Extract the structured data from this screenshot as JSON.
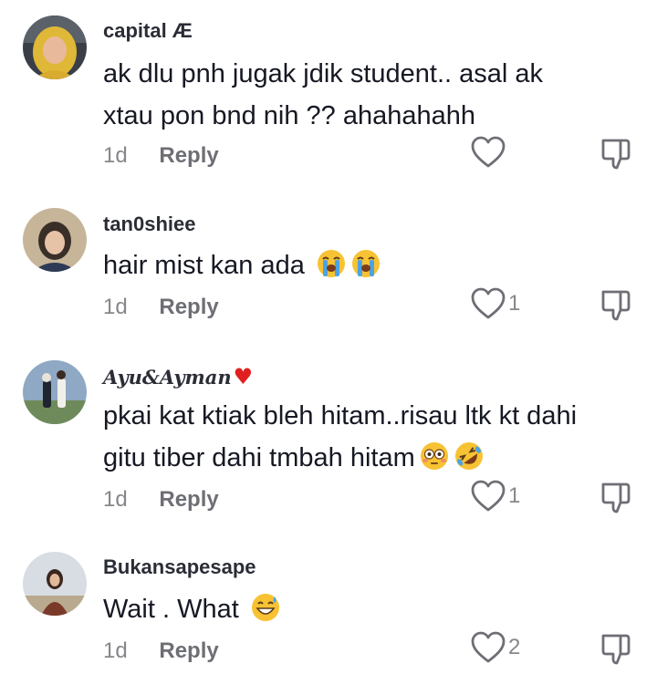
{
  "comments": [
    {
      "username": "capital Æ",
      "text_lines": [
        "ak dlu pnh jugak jdik student.. asal ak",
        "xtau pon bnd nih ?? ahahahahh"
      ],
      "time": "1d",
      "reply_label": "Reply",
      "like_count": "",
      "avatar_icon": "user-avatar-hijab"
    },
    {
      "username": "tan0shiee",
      "text": "hair mist kan ada",
      "emojis": [
        "loudly-crying-face-icon",
        "loudly-crying-face-icon"
      ],
      "time": "1d",
      "reply_label": "Reply",
      "like_count": "1",
      "avatar_icon": "user-avatar-child"
    },
    {
      "username": "Ayu&Ayman",
      "username_badge": "♥",
      "text_lines": [
        "pkai kat ktiak bleh hitam..risau ltk kt dahi",
        "gitu tiber dahi tmbah hitam"
      ],
      "emojis": [
        "flushed-face-icon",
        "rolling-on-floor-laughing-icon"
      ],
      "time": "1d",
      "reply_label": "Reply",
      "like_count": "1",
      "avatar_icon": "user-avatar-couple"
    },
    {
      "username": "Bukansapesape",
      "text": "Wait . What",
      "emojis": [
        "grinning-sweat-face-icon"
      ],
      "time": "1d",
      "reply_label": "Reply",
      "like_count": "2",
      "avatar_icon": "user-avatar-person"
    }
  ],
  "colors": {
    "text": "#161823",
    "meta": "#86878b",
    "badge_heart": "#e02020"
  }
}
